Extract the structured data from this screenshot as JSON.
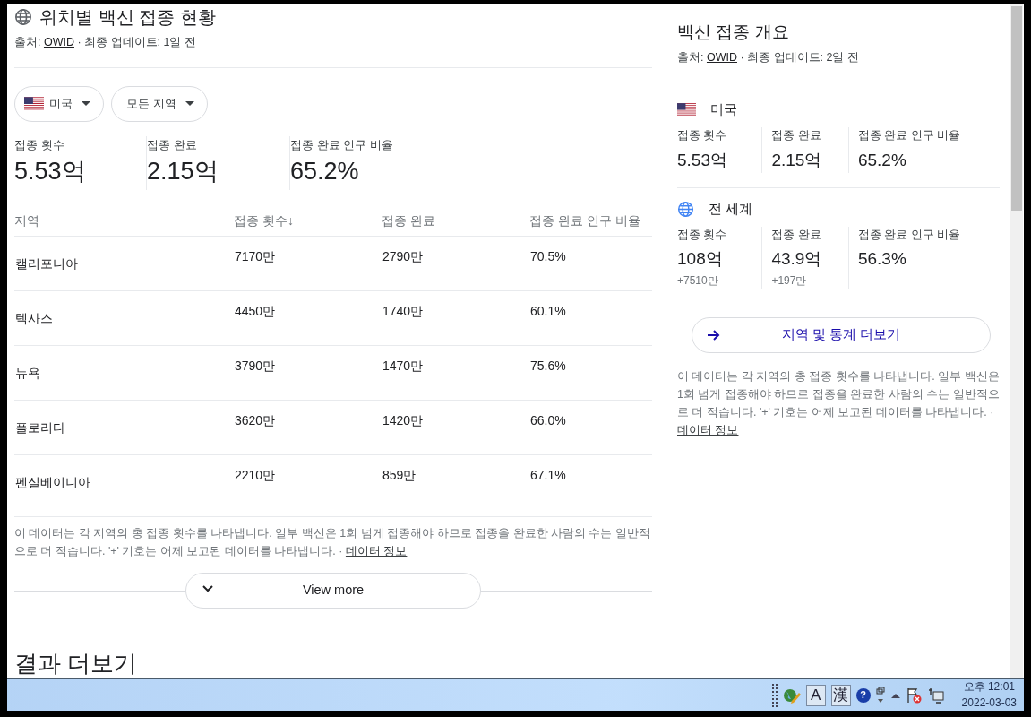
{
  "main": {
    "title": "위치별 백신 접종 현황",
    "source_label": "출처: ",
    "source_link": "OWID",
    "updated": " · 최종 업데이트: 1일 전",
    "filters": [
      {
        "label": "미국",
        "kind": "flag"
      },
      {
        "label": "모든 지역",
        "kind": "plain"
      }
    ],
    "stats": [
      {
        "label": "접종 횟수",
        "value": "5.53억"
      },
      {
        "label": "접종 완료",
        "value": "2.15억"
      },
      {
        "label": "접종 완료 인구 비율",
        "value": "65.2%"
      }
    ],
    "table": {
      "columns": [
        "지역",
        "접종 횟수↓",
        "접종 완료",
        "접종 완료 인구 비율"
      ],
      "rows": [
        [
          "캘리포니아",
          "7170만",
          "2790만",
          "70.5%"
        ],
        [
          "텍사스",
          "4450만",
          "1740만",
          "60.1%"
        ],
        [
          "뉴욕",
          "3790만",
          "1470만",
          "75.6%"
        ],
        [
          "플로리다",
          "3620만",
          "1420만",
          "66.0%"
        ],
        [
          "펜실베이니아",
          "2210만",
          "859만",
          "67.1%"
        ]
      ]
    },
    "note": "이 데이터는 각 지역의 총 접종 횟수를 나타냅니다. 일부 백신은 1회 넘게 접종해야 하므로 접종을 완료한 사람의 수는 일반적으로 더 적습니다. '+' 기호는 어제 보고된 데이터를 나타냅니다.",
    "note_sep": "·",
    "note_link": "데이터 정보",
    "view_more": "View more",
    "more_results": "결과 더보기"
  },
  "side": {
    "title": "백신 접종 개요",
    "source_label": "출처: ",
    "source_link": "OWID",
    "updated": " · 최종 업데이트: 2일 전",
    "groups": [
      {
        "name": "미국",
        "kind": "flag",
        "stats": [
          {
            "label": "접종 횟수",
            "value": "5.53억"
          },
          {
            "label": "접종 완료",
            "value": "2.15억"
          },
          {
            "label": "접종 완료 인구 비율",
            "value": "65.2%"
          }
        ]
      },
      {
        "name": "전 세계",
        "kind": "globe",
        "stats": [
          {
            "label": "접종 횟수",
            "value": "108억",
            "delta": "+7510만"
          },
          {
            "label": "접종 완료",
            "value": "43.9억",
            "delta": "+197만"
          },
          {
            "label": "접종 완료 인구 비율",
            "value": "56.3%"
          }
        ]
      }
    ],
    "more_button": "지역 및 통계 더보기",
    "note": "이 데이터는 각 지역의 총 접종 횟수를 나타냅니다. 일부 백신은 1회 넘게 접종해야 하므로 접종을 완료한 사람의 수는 일반적으로 더 적습니다. '+' 기호는 어제 보고된 데이터를 나타냅니다.",
    "note_sep": "·",
    "note_link": "데이터 정보"
  },
  "taskbar": {
    "ime_letter": "A",
    "ime_hanja": "漢",
    "help": "?",
    "time": "오후 12:01",
    "date": "2022-03-03"
  }
}
